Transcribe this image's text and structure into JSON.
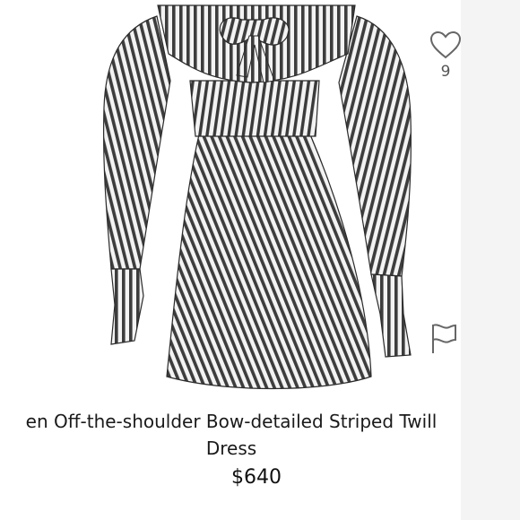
{
  "product": {
    "title_line1": "en Off-the-shoulder Bow-detailed Striped Twill",
    "title_line2": "Dress",
    "price": "$640"
  },
  "likes": {
    "count": "9",
    "icon": "heart-outline-icon"
  },
  "report": {
    "icon": "flag-outline-icon"
  },
  "colors": {
    "stripe_dark": "#3d3d3d",
    "stripe_light": "#f3f3f3",
    "icon": "#666666",
    "text": "#1a1a1a"
  }
}
